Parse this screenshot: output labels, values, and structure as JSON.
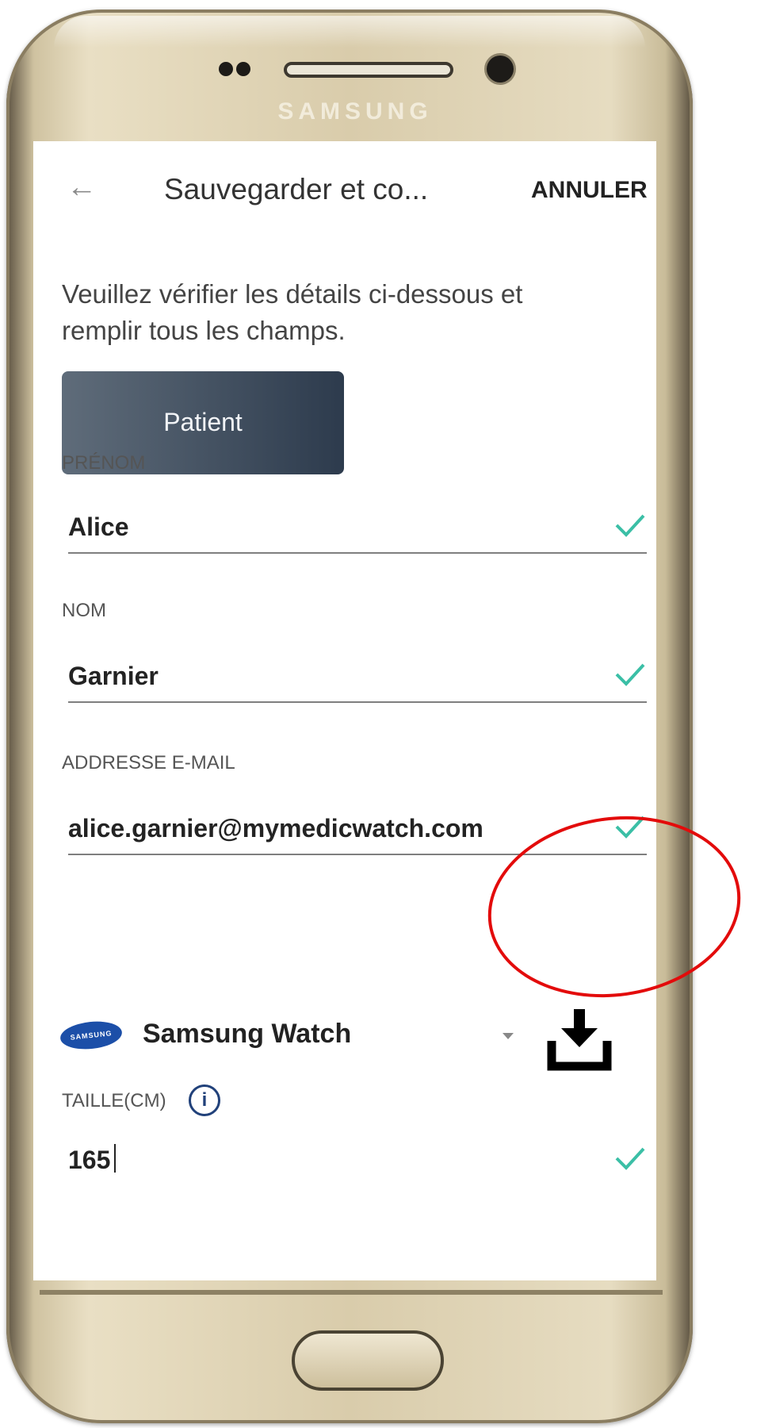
{
  "device": {
    "brand": "SAMSUNG"
  },
  "app_bar": {
    "back_icon": "arrow-left-icon",
    "title": "Sauvegarder et co...",
    "cancel_label": "ANNULER"
  },
  "instructions": "Veuillez vérifier les détails ci-dessous et remplir tous les champs.",
  "patient_button": "Patient",
  "fields": {
    "first_name": {
      "label": "PRÉNOM",
      "value": "Alice",
      "valid": true
    },
    "last_name": {
      "label": "NOM",
      "value": "Garnier",
      "valid": true
    },
    "email": {
      "label": "ADDRESSE E-MAIL",
      "value": "alice.garnier@mymedicwatch.com",
      "valid": true
    },
    "height": {
      "label": "TAILLE(CM)",
      "value": "165",
      "valid": true
    }
  },
  "device_select": {
    "logo_text": "SAMSUNG",
    "selected": "Samsung Watch"
  },
  "colors": {
    "check": "#3bbfa6",
    "patient_button_dark": "#2d3b4d",
    "annotation": "#e30b0b",
    "info_icon": "#21417a"
  },
  "icons": {
    "check": "check-icon",
    "download": "download-icon",
    "info": "info-icon",
    "dropdown": "dropdown-arrow-icon"
  }
}
